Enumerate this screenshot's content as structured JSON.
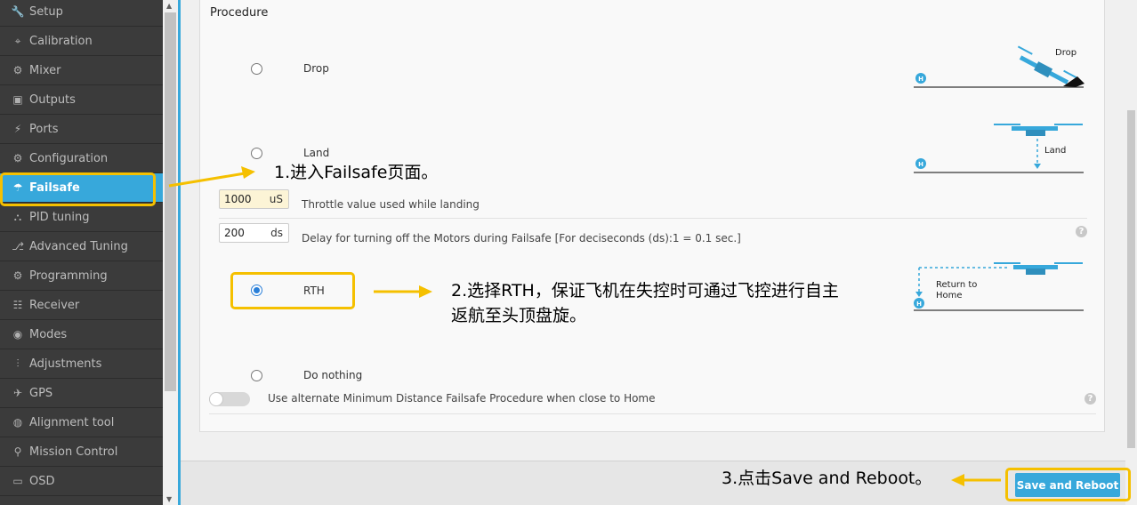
{
  "sidebar": {
    "items": [
      {
        "label": "Setup",
        "icon": "wrench-icon",
        "glyph": "🔧"
      },
      {
        "label": "Calibration",
        "icon": "crosshair-icon",
        "glyph": "⌖"
      },
      {
        "label": "Mixer",
        "icon": "mixer-icon",
        "glyph": "⚙"
      },
      {
        "label": "Outputs",
        "icon": "outputs-icon",
        "glyph": "▣"
      },
      {
        "label": "Ports",
        "icon": "plug-icon",
        "glyph": "⚡"
      },
      {
        "label": "Configuration",
        "icon": "gear-icon",
        "glyph": "⚙"
      },
      {
        "label": "Failsafe",
        "icon": "parachute-icon",
        "glyph": "☂"
      },
      {
        "label": "PID tuning",
        "icon": "pid-icon",
        "glyph": "⛬"
      },
      {
        "label": "Advanced Tuning",
        "icon": "advanced-tuning-icon",
        "glyph": "⎇"
      },
      {
        "label": "Programming",
        "icon": "gear-icon",
        "glyph": "⚙"
      },
      {
        "label": "Receiver",
        "icon": "receiver-icon",
        "glyph": "☷"
      },
      {
        "label": "Modes",
        "icon": "modes-icon",
        "glyph": "◉"
      },
      {
        "label": "Adjustments",
        "icon": "sliders-icon",
        "glyph": "⫶"
      },
      {
        "label": "GPS",
        "icon": "satellite-icon",
        "glyph": "✈"
      },
      {
        "label": "Alignment tool",
        "icon": "alignment-icon",
        "glyph": "◍"
      },
      {
        "label": "Mission Control",
        "icon": "map-pin-icon",
        "glyph": "⚲"
      },
      {
        "label": "OSD",
        "icon": "osd-icon",
        "glyph": "▭"
      }
    ],
    "active": "Failsafe"
  },
  "procedure": {
    "title": "Procedure",
    "options": {
      "drop": "Drop",
      "land": "Land",
      "rth": "RTH",
      "do_nothing": "Do nothing"
    },
    "selected": "RTH",
    "throttle": {
      "value": "1000",
      "unit": "uS",
      "description": "Throttle value used while landing"
    },
    "delay": {
      "value": "200",
      "unit": "ds",
      "description": "Delay for turning off the Motors during Failsafe [For deciseconds (ds):1 = 0.1 sec.]"
    },
    "min_distance_toggle": {
      "label": "Use alternate Minimum Distance Failsafe Procedure when close to Home",
      "enabled": false
    },
    "help_glyph": "?"
  },
  "illustrations": {
    "drop_label": "Drop",
    "land_label": "Land",
    "rth_label_line1": "Return to",
    "rth_label_line2": "Home",
    "home_marker": "H"
  },
  "footer": {
    "save_label": "Save and Reboot"
  },
  "annotations": {
    "step1": "1.进入Failsafe页面。",
    "step2_line1": "2.选择RTH，保证飞机在失控时可通过飞控进行自主",
    "step2_line2": "返航至头顶盘旋。",
    "step3": "3.点击Save and Reboot。"
  },
  "colors": {
    "accent": "#37a8db",
    "annotation": "#f5c000",
    "sidebar_bg": "#3b3b3b"
  }
}
